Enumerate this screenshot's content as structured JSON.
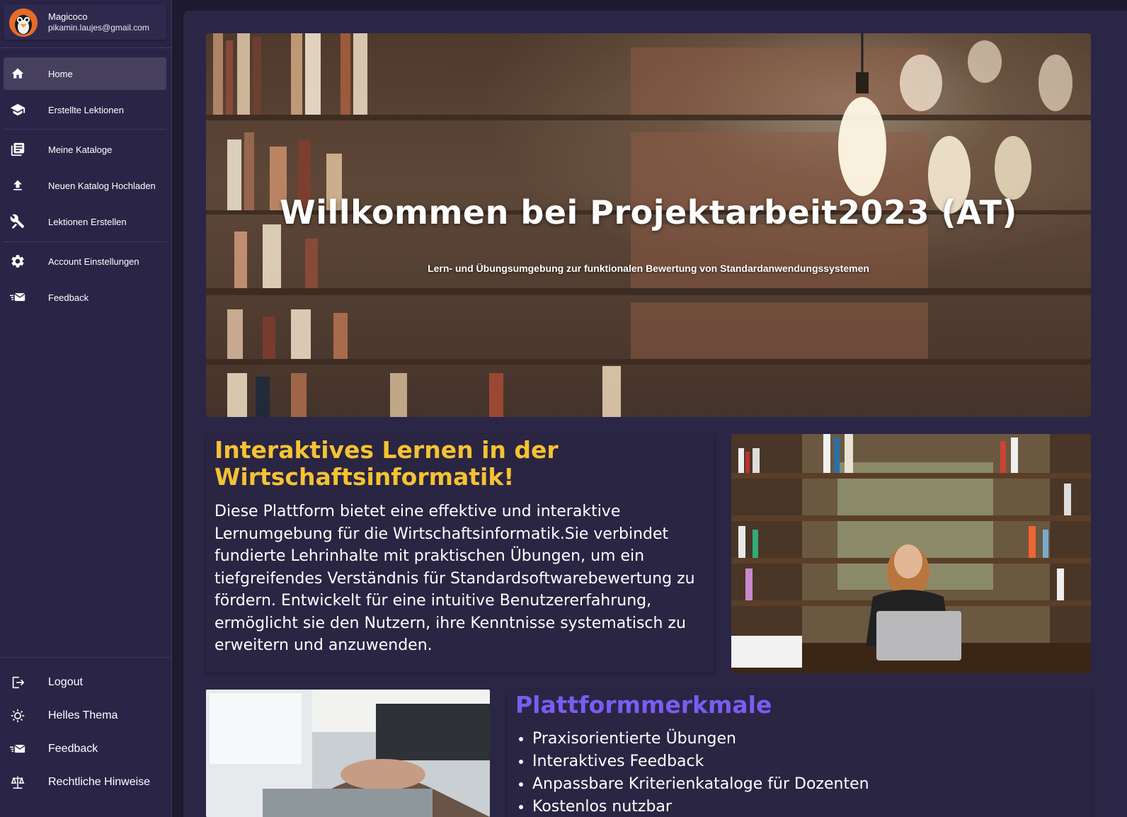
{
  "user": {
    "name": "Magicoco",
    "email": "pikamin.laujes@gmail.com"
  },
  "nav": {
    "home": "Home",
    "created_lessons": "Erstellte Lektionen",
    "my_catalogs": "Meine Kataloge",
    "upload_catalog": "Neuen Katalog Hochladen",
    "create_lessons": "Lektionen Erstellen",
    "account_settings": "Account Einstellungen",
    "feedback": "Feedback"
  },
  "bottom_nav": {
    "logout": "Logout",
    "light_theme": "Helles Thema",
    "feedback": "Feedback",
    "legal": "Rechtliche Hinweise"
  },
  "hero": {
    "title": "Willkommen bei Projektarbeit2023 (AT)",
    "subtitle": "Lern- und Übungsumgebung zur funktionalen Bewertung von Standardanwendungssystemen"
  },
  "intro": {
    "title": "Interaktives Lernen in der Wirtschaftsinformatik!",
    "text": "Diese Plattform bietet eine effektive und interaktive Lernumgebung für die Wirtschaftsinformatik.Sie verbindet fundierte Lehrinhalte mit praktischen Übungen, um ein tiefgreifendes Verständnis für Standardsoftwarebewertung zu fördern. Entwickelt für eine intuitive Benutzererfahrung, ermöglicht sie den Nutzern, ihre Kenntnisse systematisch zu erweitern und anzuwenden."
  },
  "features": {
    "title": "Plattformmerkmale",
    "items": [
      "Praxisorientierte Übungen",
      "Interaktives Feedback",
      "Anpassbare Kriterienkataloge für Dozenten",
      "Kostenlos nutzbar"
    ]
  },
  "colors": {
    "accent_yellow": "#f5c232",
    "accent_purple": "#7a5cf2",
    "sidebar_bg": "#2a2547",
    "main_bg": "#2b2646"
  }
}
